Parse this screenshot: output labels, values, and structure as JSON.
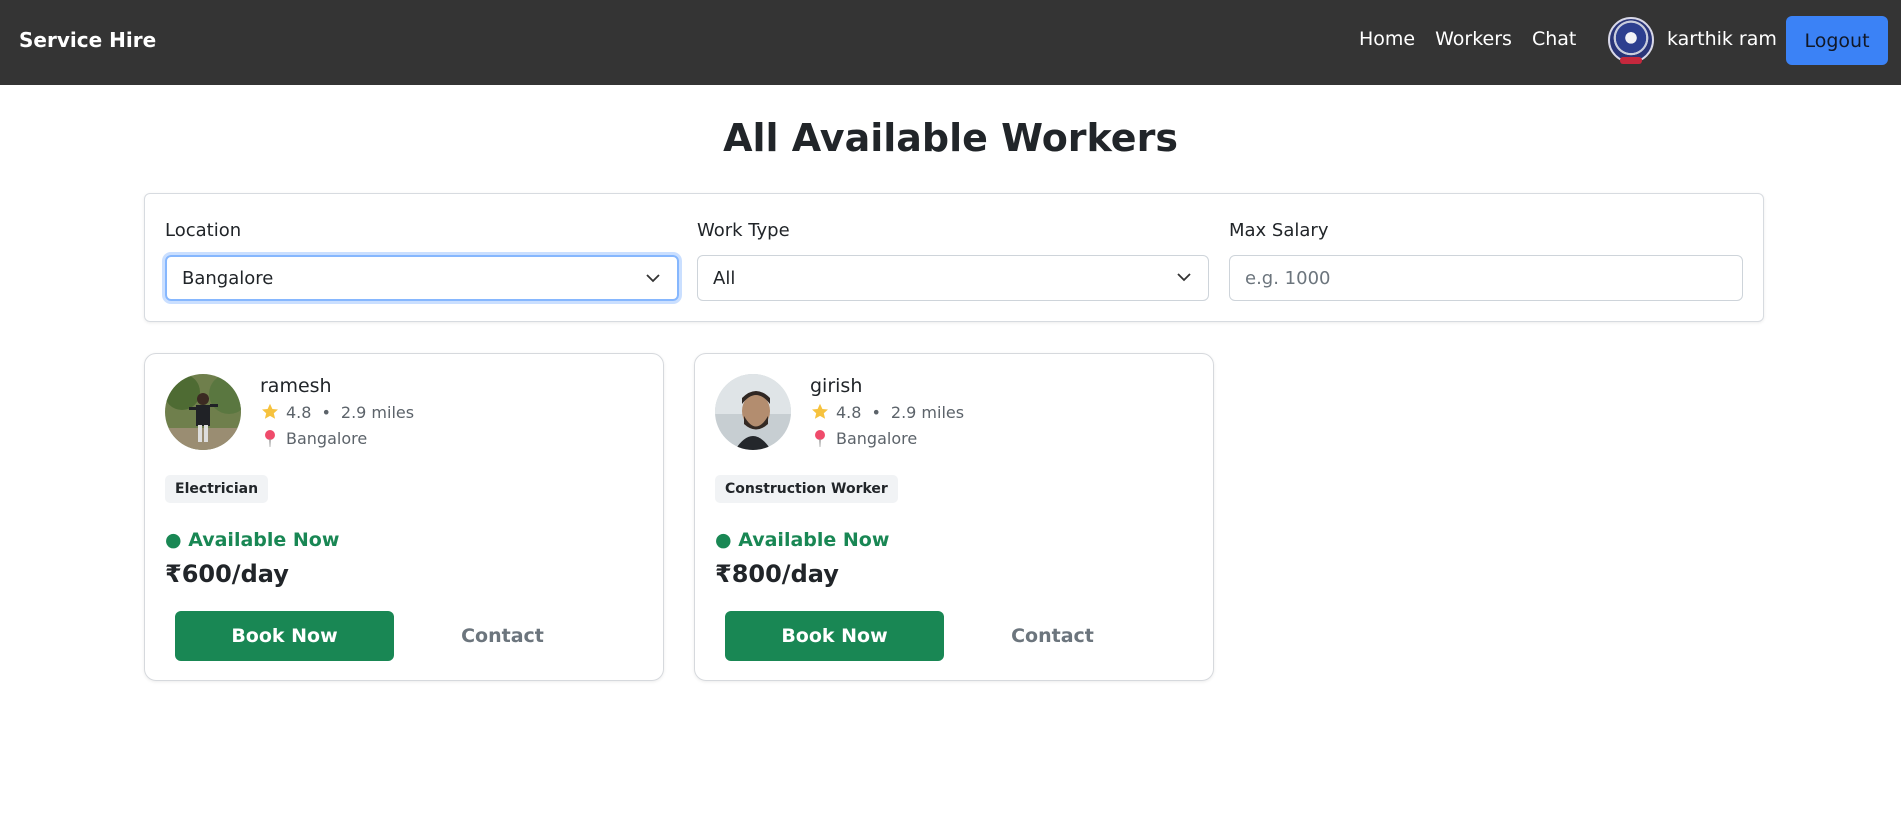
{
  "header": {
    "brand": "Service Hire",
    "nav": [
      "Home",
      "Workers",
      "Chat"
    ],
    "user_name": "karthik ram",
    "logout_label": "Logout"
  },
  "page": {
    "title": "All Available Workers"
  },
  "filters": {
    "location_label": "Location",
    "location_value": "Bangalore",
    "worktype_label": "Work Type",
    "worktype_value": "All",
    "salary_label": "Max Salary",
    "salary_placeholder": "e.g. 1000"
  },
  "workers": [
    {
      "name": "ramesh",
      "rating": "4.8",
      "distance": "2.9 miles",
      "location": "Bangalore",
      "skill": "Electrician",
      "status": "● Available Now",
      "rate": "₹600/day",
      "book_label": "Book Now",
      "contact_label": "Contact"
    },
    {
      "name": "girish",
      "rating": "4.8",
      "distance": "2.9 miles",
      "location": "Bangalore",
      "skill": "Construction Worker",
      "status": "● Available Now",
      "rate": "₹800/day",
      "book_label": "Book Now",
      "contact_label": "Contact"
    }
  ],
  "separator": "•",
  "colors": {
    "navbar": "#343434",
    "logout": "#3b82f6",
    "book": "#198754",
    "available": "#198754"
  }
}
